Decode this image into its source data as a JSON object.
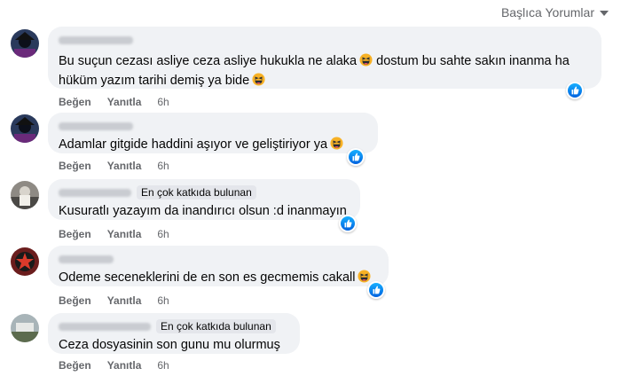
{
  "sort": {
    "label": "Başlıca Yorumlar"
  },
  "comments": [
    {
      "badge": "",
      "lines": [
        "Bu suçun cezası asliye ceza asliye hukukla ne alaka",
        "dostum bu sahte sakın inanma ha",
        "hüküm yazım tarihi demiş ya bide"
      ],
      "like_label": "Beğen",
      "reply_label": "Yanıtla",
      "time": "6h"
    },
    {
      "badge": "",
      "lines": [
        "Adamlar gitgide haddini aşıyor ve geliştiriyor ya"
      ],
      "like_label": "Beğen",
      "reply_label": "Yanıtla",
      "time": "6h"
    },
    {
      "badge": "En çok katkıda bulunan",
      "lines": [
        "Kusuratlı yazayım da inandırıcı olsun :d inanmayın"
      ],
      "like_label": "Beğen",
      "reply_label": "Yanıtla",
      "time": "6h"
    },
    {
      "badge": "",
      "lines": [
        "Odeme seceneklerini de en son es gecmemis cakall"
      ],
      "like_label": "Beğen",
      "reply_label": "Yanıtla",
      "time": "6h"
    },
    {
      "badge": "En çok katkıda bulunan",
      "lines": [
        "Ceza dosyasinin son gunu mu olurmuş"
      ],
      "like_label": "Beğen",
      "reply_label": "Yanıtla",
      "time": "6h"
    }
  ],
  "icons": {
    "reaction": "laughing-emoji-icon",
    "like": "like-thumb-icon",
    "sort": "chevron-down-icon"
  },
  "colors": {
    "bubble": "#f0f2f5",
    "meta_text": "#65676b",
    "like_blue": "#1877f2"
  }
}
